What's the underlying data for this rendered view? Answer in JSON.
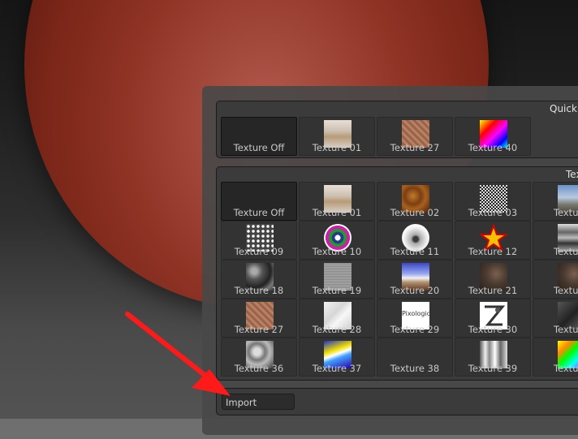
{
  "quick_panel": {
    "title": "Quick I",
    "items": [
      {
        "label": "Texture Off",
        "thumb": "none",
        "selected": true
      },
      {
        "label": "Texture 01",
        "thumb": "room"
      },
      {
        "label": "Texture 27",
        "thumb": "brick"
      },
      {
        "label": "Texture 40",
        "thumb": "rainbow"
      }
    ]
  },
  "texture_panel": {
    "title": "Textur",
    "rows": [
      [
        {
          "label": "Texture Off",
          "thumb": "none",
          "selected": true
        },
        {
          "label": "Texture 01",
          "thumb": "room"
        },
        {
          "label": "Texture 02",
          "thumb": "wood"
        },
        {
          "label": "Texture 03",
          "thumb": "check"
        },
        {
          "label": "Texture",
          "thumb": "sky"
        }
      ],
      [
        {
          "label": "Texture 09",
          "thumb": "cells"
        },
        {
          "label": "Texture 10",
          "thumb": "target"
        },
        {
          "label": "Texture 11",
          "thumb": "sphere"
        },
        {
          "label": "Texture 12",
          "thumb": "star"
        },
        {
          "label": "Texture",
          "thumb": "machine"
        }
      ],
      [
        {
          "label": "Texture 18",
          "thumb": "rock"
        },
        {
          "label": "Texture 19",
          "thumb": "noise"
        },
        {
          "label": "Texture 20",
          "thumb": "mountain"
        },
        {
          "label": "Texture 21",
          "thumb": "dirt"
        },
        {
          "label": "Texture",
          "thumb": "dirt"
        }
      ],
      [
        {
          "label": "Texture 27",
          "thumb": "brick"
        },
        {
          "label": "Texture 28",
          "thumb": "marble"
        },
        {
          "label": "Texture 29",
          "thumb": "logo"
        },
        {
          "label": "Texture 30",
          "thumb": "zbrush"
        },
        {
          "label": "Texture",
          "thumb": "hex"
        }
      ],
      [
        {
          "label": "Texture 36",
          "thumb": "cloud"
        },
        {
          "label": "Texture 37",
          "thumb": "abstract"
        },
        {
          "label": "Texture 38",
          "thumb": "none"
        },
        {
          "label": "Texture 39",
          "thumb": "chrome"
        },
        {
          "label": "Texture",
          "thumb": "rainbow2"
        }
      ]
    ]
  },
  "logo_text": "Pixologic",
  "import_button": {
    "label": "Import"
  },
  "colors": {
    "arrow": "#ff1a1a",
    "sphere": "#8f3325"
  }
}
